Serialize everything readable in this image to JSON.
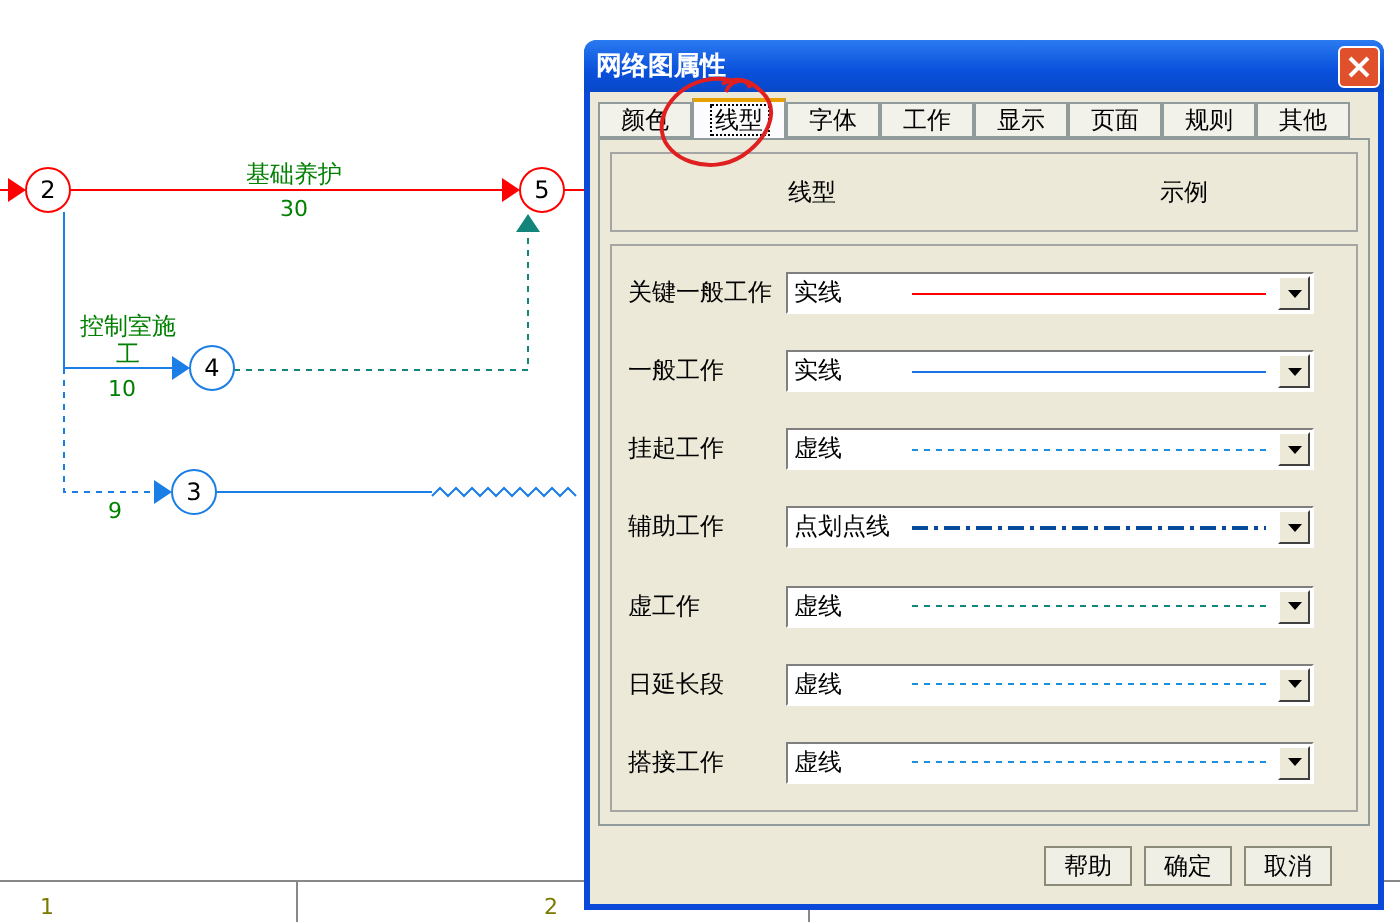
{
  "diagram": {
    "nodes": [
      {
        "label": "2",
        "critical": true
      },
      {
        "label": "5",
        "critical": true
      },
      {
        "label": "4",
        "critical": false
      },
      {
        "label": "3",
        "critical": false
      }
    ],
    "activities": [
      {
        "name": "基础养护",
        "duration": "30",
        "critical": true
      },
      {
        "name": "控制室施工",
        "duration": "10",
        "critical": false
      },
      {
        "duration": "9",
        "critical": false
      }
    ],
    "ruler": [
      "1",
      "2"
    ]
  },
  "dialog": {
    "title": "网络图属性",
    "tabs": [
      {
        "label": "颜色",
        "selected": false
      },
      {
        "label": "线型",
        "selected": true
      },
      {
        "label": "字体",
        "selected": false
      },
      {
        "label": "工作",
        "selected": false
      },
      {
        "label": "显示",
        "selected": false
      },
      {
        "label": "页面",
        "selected": false
      },
      {
        "label": "规则",
        "selected": false
      },
      {
        "label": "其他",
        "selected": false
      }
    ],
    "columns": [
      "线型",
      "示例"
    ],
    "rows": [
      {
        "label": "关键一般工作",
        "value": "实线",
        "kind": "solid",
        "color": "#ff0000"
      },
      {
        "label": "一般工作",
        "value": "实线",
        "kind": "solid",
        "color": "#1a73e0"
      },
      {
        "label": "挂起工作",
        "value": "虚线",
        "kind": "dashed",
        "color": "#1c8fe0"
      },
      {
        "label": "辅助工作",
        "value": "点划点线",
        "kind": "dashdot",
        "color": "#0a4a9a"
      },
      {
        "label": "虚工作",
        "value": "虚线",
        "kind": "dashed",
        "color": "#14857a"
      },
      {
        "label": "日延长段",
        "value": "虚线",
        "kind": "dashed",
        "color": "#1c8fe0"
      },
      {
        "label": "搭接工作",
        "value": "虚线",
        "kind": "dashed",
        "color": "#1c8fe0"
      }
    ],
    "buttons": [
      "帮助",
      "确定",
      "取消"
    ]
  }
}
